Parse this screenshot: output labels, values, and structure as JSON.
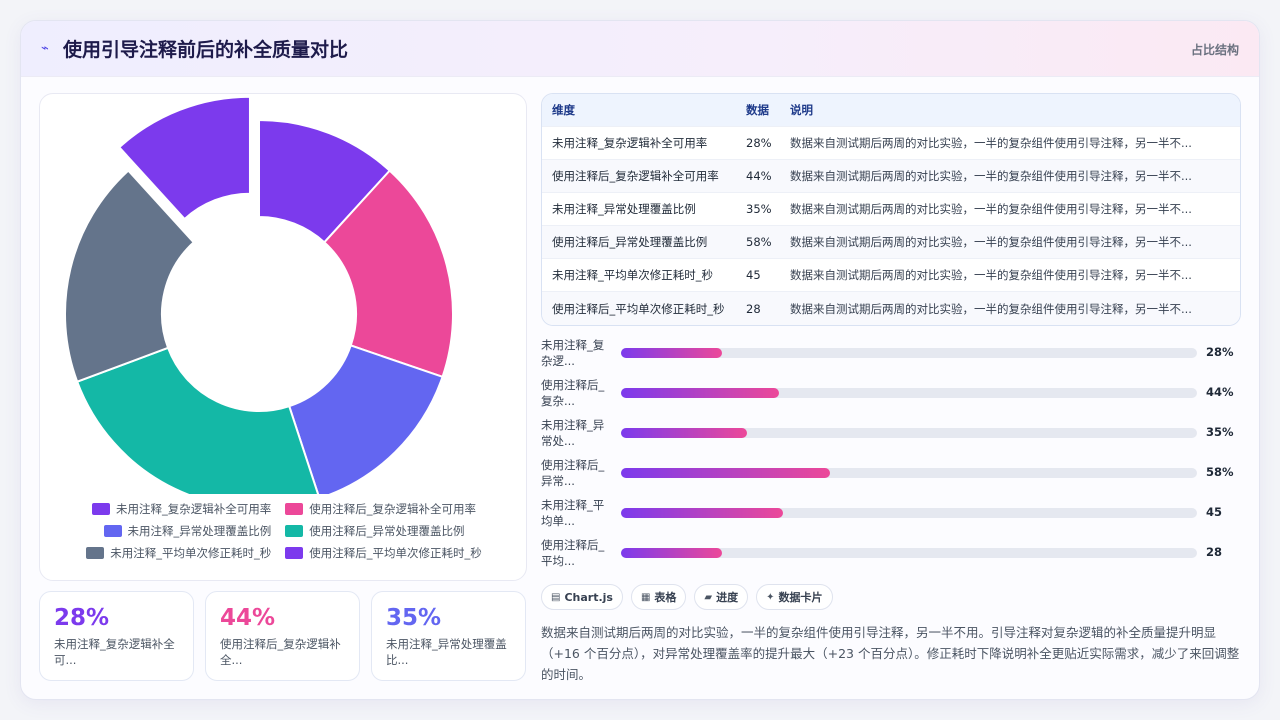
{
  "header": {
    "title": "使用引导注释前后的补全质量对比",
    "badge": "占比结构"
  },
  "colors": {
    "palette": [
      "#7c3aed",
      "#ec4899",
      "#6366f1",
      "#14b8a6",
      "#64748b",
      "#7c3aed"
    ],
    "bar_gradient": [
      "#7c3aed",
      "#ec4899"
    ]
  },
  "chart_data": {
    "type": "pie",
    "variant": "donut",
    "categories": [
      "未用注释_复杂逻辑补全可用率",
      "使用注释后_复杂逻辑补全可用率",
      "未用注释_异常处理覆盖比例",
      "使用注释后_异常处理覆盖比例",
      "未用注释_平均单次修正耗时_秒",
      "使用注释后_平均单次修正耗时_秒"
    ],
    "values": [
      28,
      44,
      35,
      58,
      45,
      28
    ],
    "exploded_index": 5,
    "legend": "bottom"
  },
  "kpis": [
    {
      "value": "28%",
      "label": "未用注释_复杂逻辑补全可...",
      "color": "#7c3aed"
    },
    {
      "value": "44%",
      "label": "使用注释后_复杂逻辑补全...",
      "color": "#ec4899"
    },
    {
      "value": "35%",
      "label": "未用注释_异常处理覆盖比...",
      "color": "#6366f1"
    }
  ],
  "table": {
    "headers": [
      "维度",
      "数据",
      "说明"
    ],
    "rows": [
      [
        "未用注释_复杂逻辑补全可用率",
        "28%",
        "数据来自测试期后两周的对比实验，一半的复杂组件使用引导注释，另一半不..."
      ],
      [
        "使用注释后_复杂逻辑补全可用率",
        "44%",
        "数据来自测试期后两周的对比实验，一半的复杂组件使用引导注释，另一半不..."
      ],
      [
        "未用注释_异常处理覆盖比例",
        "35%",
        "数据来自测试期后两周的对比实验，一半的复杂组件使用引导注释，另一半不..."
      ],
      [
        "使用注释后_异常处理覆盖比例",
        "58%",
        "数据来自测试期后两周的对比实验，一半的复杂组件使用引导注释，另一半不..."
      ],
      [
        "未用注释_平均单次修正耗时_秒",
        "45",
        "数据来自测试期后两周的对比实验，一半的复杂组件使用引导注释，另一半不..."
      ],
      [
        "使用注释后_平均单次修正耗时_秒",
        "28",
        "数据来自测试期后两周的对比实验，一半的复杂组件使用引导注释，另一半不..."
      ]
    ]
  },
  "progress": [
    {
      "label_line1": "未用注释_复",
      "label_line2": "杂逻...",
      "value": 28,
      "value_text": "28%"
    },
    {
      "label_line1": "使用注释后_",
      "label_line2": "复杂...",
      "value": 44,
      "value_text": "44%"
    },
    {
      "label_line1": "未用注释_异",
      "label_line2": "常处...",
      "value": 35,
      "value_text": "35%"
    },
    {
      "label_line1": "使用注释后_",
      "label_line2": "异常...",
      "value": 58,
      "value_text": "58%"
    },
    {
      "label_line1": "未用注释_平",
      "label_line2": "均单...",
      "value": 45,
      "value_text": "45"
    },
    {
      "label_line1": "使用注释后_",
      "label_line2": "平均...",
      "value": 28,
      "value_text": "28"
    }
  ],
  "progress_max": 160,
  "chips": [
    {
      "icon": "chart-icon",
      "glyph": "▤",
      "label": "Chart.js"
    },
    {
      "icon": "table-icon",
      "glyph": "▦",
      "label": "表格"
    },
    {
      "icon": "progress-icon",
      "glyph": "▰",
      "label": "进度"
    },
    {
      "icon": "card-icon",
      "glyph": "✦",
      "label": "数据卡片"
    }
  ],
  "summary": "数据来自测试期后两周的对比实验，一半的复杂组件使用引导注释，另一半不用。引导注释对复杂逻辑的补全质量提升明显（+16 个百分点），对异常处理覆盖率的提升最大（+23 个百分点）。修正耗时下降说明补全更贴近实际需求，减少了来回调整的时间。"
}
